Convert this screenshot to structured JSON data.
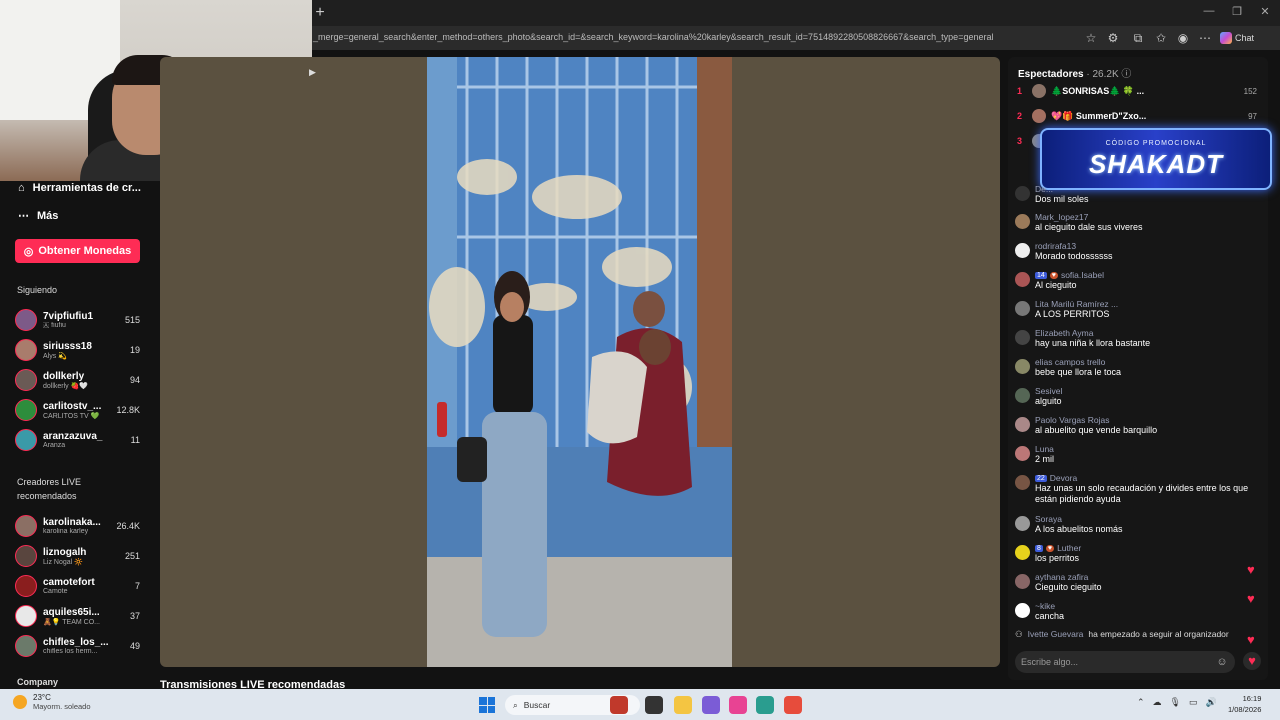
{
  "browser": {
    "url": "_merge=general_search&enter_method=others_photo&search_id=&search_keyword=karolina%20karley&search_result_id=7514892280508826667&search_type=general",
    "chat_label": "Chat",
    "new_tab": "+"
  },
  "sidebar": {
    "items": [
      {
        "label": "Herramientas de cr...",
        "icon": "home-icon"
      },
      {
        "label": "Más",
        "icon": "more-icon"
      }
    ],
    "coins_button": "Obtener Monedas",
    "following_title": "Siguiendo",
    "following": [
      {
        "name": "7vipfiufiu1",
        "sub": "🇦 fiufiu",
        "count": "515"
      },
      {
        "name": "siriusss18",
        "sub": "Alys 💫",
        "count": "19"
      },
      {
        "name": "dollkerly",
        "sub": "dollkerly 🍓🤍",
        "count": "94"
      },
      {
        "name": "carlitostv_...",
        "sub": "CARLITOS TV 💚",
        "count": "12.8K"
      },
      {
        "name": "aranzazuva_",
        "sub": "Aranza",
        "count": "11"
      }
    ],
    "recommended_title_1": "Creadores LIVE",
    "recommended_title_2": "recomendados",
    "recommended": [
      {
        "name": "karolinaka...",
        "sub": "karolina karley",
        "count": "26.4K"
      },
      {
        "name": "liznogalh",
        "sub": "Liz Nogal 🔆",
        "count": "251"
      },
      {
        "name": "camotefort",
        "sub": "Camote",
        "count": "7"
      },
      {
        "name": "aquiles65i...",
        "sub": "🧸💡 TEAM CO...",
        "count": "37"
      },
      {
        "name": "chifles_los_...",
        "sub": "chifles los herm...",
        "count": "49"
      }
    ],
    "company": "Company"
  },
  "main": {
    "recommended_title": "Transmisiones LIVE recomendadas"
  },
  "chat": {
    "viewers_label": "Espectadores",
    "viewers_count": "· 26.2K",
    "ranking": [
      {
        "rank": "1",
        "name": "🌲SONRISAS🌲 🍀 ...",
        "points": "152"
      },
      {
        "rank": "2",
        "name": "💖🎁 SummerD\"Zxo...",
        "points": "97"
      },
      {
        "rank": "3",
        "name": "",
        "points": ""
      }
    ],
    "promo_small": "CÓDIGO PROMOCIONAL",
    "promo_big": "SHAKADT",
    "messages": [
      {
        "user": "De...",
        "text": "Dos mil soles",
        "badges": []
      },
      {
        "user": "Mark_lopez17",
        "text": "al cieguito dale sus viveres",
        "badges": []
      },
      {
        "user": "rodrirafa13",
        "text": "Morado todossssss",
        "badges": []
      },
      {
        "user": "sofia.Isabel",
        "text": "Al cieguito",
        "badges": [
          "14"
        ]
      },
      {
        "user": "Lita Marilú Ramírez ...",
        "text": "A LOS PERRITOS",
        "badges": []
      },
      {
        "user": "Elizabeth Ayma",
        "text": "hay una niña k llora bastante",
        "badges": []
      },
      {
        "user": "elias campos trello",
        "text": "bebe que llora le toca",
        "badges": []
      },
      {
        "user": "Sesivel",
        "text": "alguito",
        "badges": []
      },
      {
        "user": "Paolo Vargas Rojas",
        "text": "al abuelito que vende barquillo",
        "badges": []
      },
      {
        "user": "Luna",
        "text": "2 mil",
        "badges": []
      },
      {
        "user": "Devora",
        "text": "Haz unas un solo recaudación y divides entre los que están pidiendo ayuda",
        "badges": [
          "22"
        ]
      },
      {
        "user": "Soraya",
        "text": "A los abuelitos nomás",
        "badges": []
      },
      {
        "user": "Luther",
        "text": "los perritos",
        "badges": [
          "8"
        ]
      },
      {
        "user": "aythana zafira",
        "text": "Cieguito cieguito",
        "badges": []
      },
      {
        "user": "~kike",
        "text": "cancha",
        "badges": []
      }
    ],
    "follow_user": "Ivette Guevara",
    "follow_text": "ha empezado a seguir al organizador",
    "input_placeholder": "Escribe algo..."
  },
  "taskbar": {
    "temp": "23°C",
    "weather": "Mayorm. soleado",
    "search": "Buscar",
    "time": "16:19",
    "date": "1/08/2026"
  },
  "colors": {
    "accent": "#fe2c55",
    "promo": "#2940c9"
  }
}
